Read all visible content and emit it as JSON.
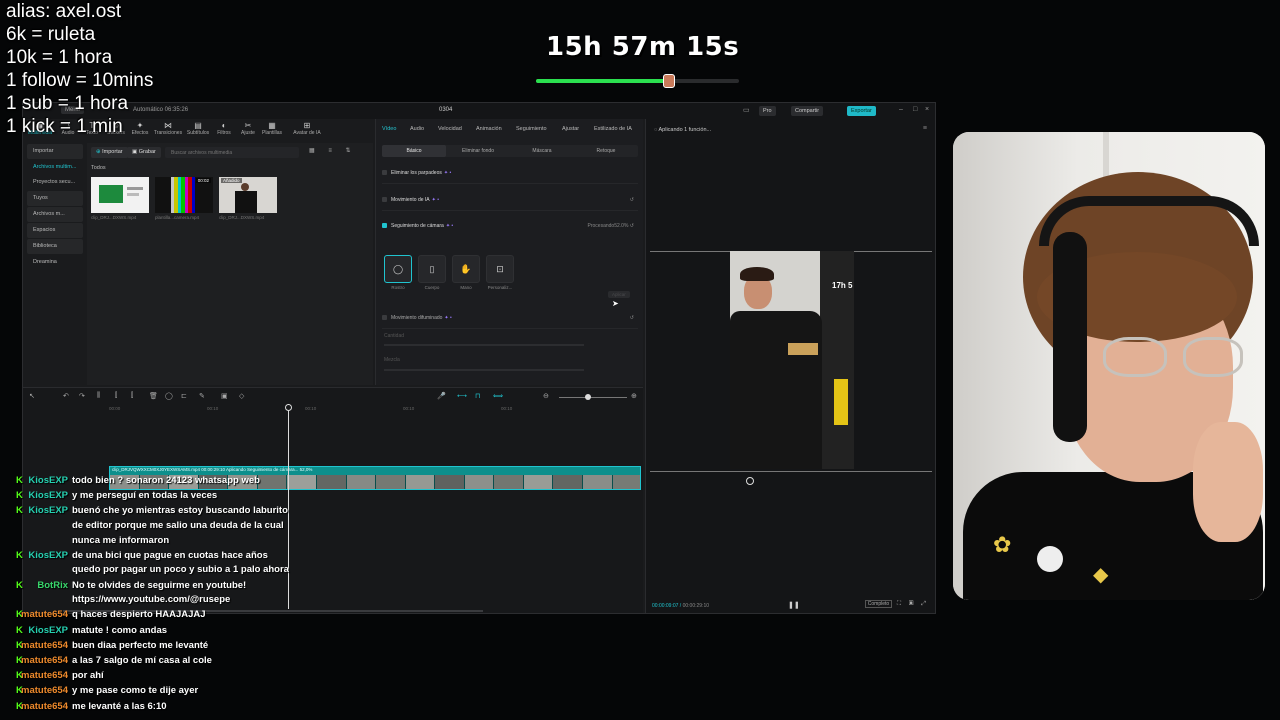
{
  "overlay": {
    "stats": [
      "alias: axel.ost",
      "6k =  ruleta",
      "10k = 1 hora",
      "1 follow = 10mins",
      "1 sub = 1 hora",
      "1 kick = 1 min"
    ],
    "timer": {
      "label": "15h 57m 15s",
      "progress_fraction": 0.65,
      "fill_color": "#2be04f"
    }
  },
  "editor": {
    "titlebar": {
      "menu": "Menú",
      "date": "Automático 06:35:26",
      "project": "0304",
      "pro": "Pro",
      "share": "Compartir",
      "export": "Exportar"
    },
    "media_toolbar": [
      "Multimedia",
      "Audio",
      "Texto",
      "Stickers",
      "Efectos",
      "Transiciones",
      "Subtítulos",
      "Filtros",
      "Ajuste",
      "Plantillas",
      "Avatar de IA"
    ],
    "left_nav": [
      {
        "label": "Importar",
        "boxed": true
      },
      {
        "label": "Archivos multim...",
        "active": true
      },
      {
        "label": "Proyectos secu..."
      },
      {
        "label": "Tuyos",
        "boxed": true
      },
      {
        "label": "Archivos m...",
        "boxed": true
      },
      {
        "label": "Espacios",
        "boxed": true
      },
      {
        "label": "Biblioteca",
        "boxed": true
      },
      {
        "label": "Dreamina"
      }
    ],
    "media": {
      "import_btn": "Importar",
      "record_btn": "Grabar",
      "search_placeholder": "Buscar archivos multimedia",
      "all_label": "Todos",
      "items": [
        {
          "caption": "clip_DRJ...DXWS.mp4",
          "badge": ""
        },
        {
          "caption": "plantilla...camera.mp4",
          "badge": "00:02"
        },
        {
          "caption": "clip_DRJ...DXWS.mp4",
          "badge": "Añadido"
        }
      ]
    },
    "props": {
      "tabs": [
        "Vídeo",
        "Audio",
        "Velocidad",
        "Animación",
        "Seguimiento",
        "Ajustar",
        "Estilizado de IA"
      ],
      "subtabs": [
        "Básico",
        "Eliminar fondo",
        "Máscara",
        "Retoque"
      ],
      "rows": {
        "blink": "Eliminar los parpadeos",
        "ai_motion": "Movimiento de IA",
        "camera_tracking": "Seguimiento de cámara",
        "processing": "Procesando52.0%",
        "motion_blur": "Movimiento difuminado",
        "blur_amount": "Cantidad",
        "blur_dir": "Mezcla",
        "apply": "Aplicar"
      },
      "modes": [
        "Rostro",
        "Cuerpo",
        "Mano",
        "Personaliz..."
      ]
    },
    "player": {
      "status": "Aplicando 1 función...",
      "timecode_current": "00:00:09:07",
      "timecode_total": "00:00:29:10",
      "preview_overlay": "17h 5",
      "complete": "Completo"
    },
    "timeline": {
      "ruler": [
        "00:00",
        "00:10",
        "00:10",
        "00:10",
        "00:10"
      ],
      "clip_title": "clip_DRJVQWXXCM0XJ0YEXWSAMS.mp4   00:00:29:10   Aplicando Seguimiento de cámara... 52,0%"
    }
  },
  "chat": [
    {
      "user": "KiosEXP",
      "user_color": "#26d0b0",
      "lines": [
        "todo bien ? sonaron 24123 whatsapp web"
      ]
    },
    {
      "user": "KiosEXP",
      "user_color": "#26d0b0",
      "lines": [
        "y me perseguí en todas la veces"
      ]
    },
    {
      "user": "KiosEXP",
      "user_color": "#26d0b0",
      "lines": [
        "buenó che yo mientras estoy buscando laburito",
        "de editor porque me salio una deuda de la cual",
        "nunca me informaron"
      ]
    },
    {
      "user": "KiosEXP",
      "user_color": "#26d0b0",
      "lines": [
        "de una bici que pague en cuotas hace años",
        "quedo por pagar un poco y subio a 1 palo ahora"
      ]
    },
    {
      "user": "BotRix",
      "user_color": "#38d66b",
      "lines": [
        "No te olvides de seguirme en youtube!",
        "https://www.youtube.com/@rusepe"
      ]
    },
    {
      "user": "matute654",
      "user_color": "#ee8a2c",
      "lines": [
        "q haces despierto HAAJAJAJ"
      ]
    },
    {
      "user": "KiosEXP",
      "user_color": "#26d0b0",
      "lines": [
        "matute ! como andas"
      ]
    },
    {
      "user": "matute654",
      "user_color": "#ee8a2c",
      "lines": [
        "buen diaa perfecto me levanté"
      ]
    },
    {
      "user": "matute654",
      "user_color": "#ee8a2c",
      "lines": [
        "a las 7 salgo de mí casa al cole"
      ]
    },
    {
      "user": "matute654",
      "user_color": "#ee8a2c",
      "lines": [
        "por ahí"
      ]
    },
    {
      "user": "matute654",
      "user_color": "#ee8a2c",
      "lines": [
        "y me pase como te dije ayer"
      ]
    },
    {
      "user": "matute654",
      "user_color": "#ee8a2c",
      "lines": [
        "me levanté a las 6:10"
      ]
    }
  ],
  "colors": {
    "accent": "#20c4cf",
    "kick_green": "#53fc18"
  }
}
